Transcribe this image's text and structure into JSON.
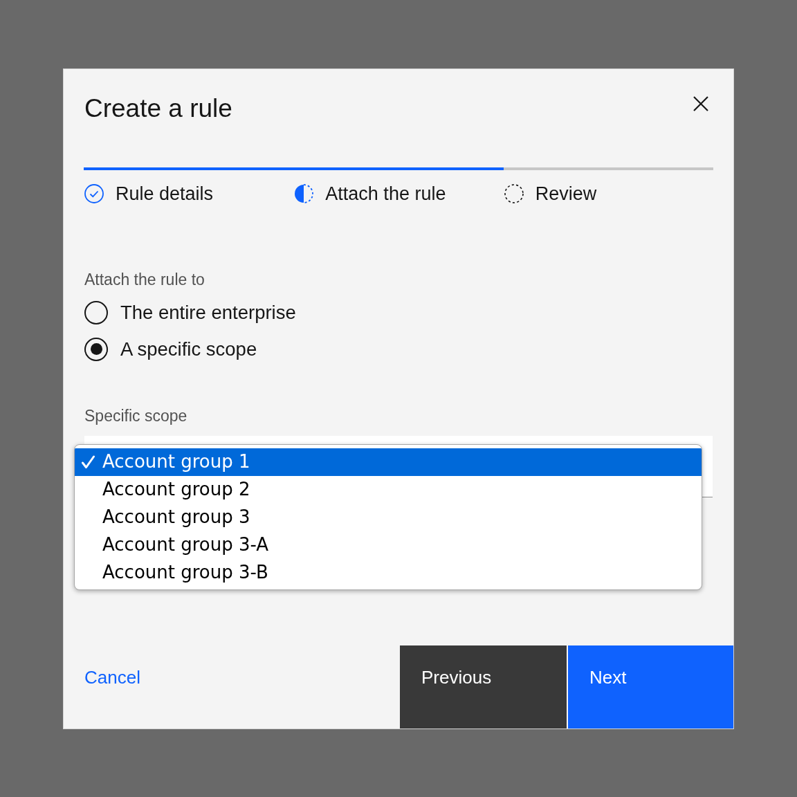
{
  "dialog": {
    "title": "Create a rule"
  },
  "progress": {
    "steps": [
      {
        "label": "Rule details",
        "kind": "complete"
      },
      {
        "label": "Attach the rule",
        "kind": "current"
      },
      {
        "label": "Review",
        "kind": "incomplete"
      }
    ]
  },
  "attach_group": {
    "label": "Attach the rule to",
    "options": [
      {
        "label": "The entire enterprise",
        "selected": false
      },
      {
        "label": "A specific scope",
        "selected": true
      }
    ]
  },
  "scope_select": {
    "label": "Specific scope",
    "expanded": true,
    "options": [
      {
        "label": "Account group 1",
        "selected": true
      },
      {
        "label": "Account group 2",
        "selected": false
      },
      {
        "label": "Account group 3",
        "selected": false
      },
      {
        "label": "Account group 3-A",
        "selected": false
      },
      {
        "label": "Account group 3-B",
        "selected": false
      }
    ]
  },
  "footer": {
    "cancel": "Cancel",
    "previous": "Previous",
    "next": "Next"
  }
}
